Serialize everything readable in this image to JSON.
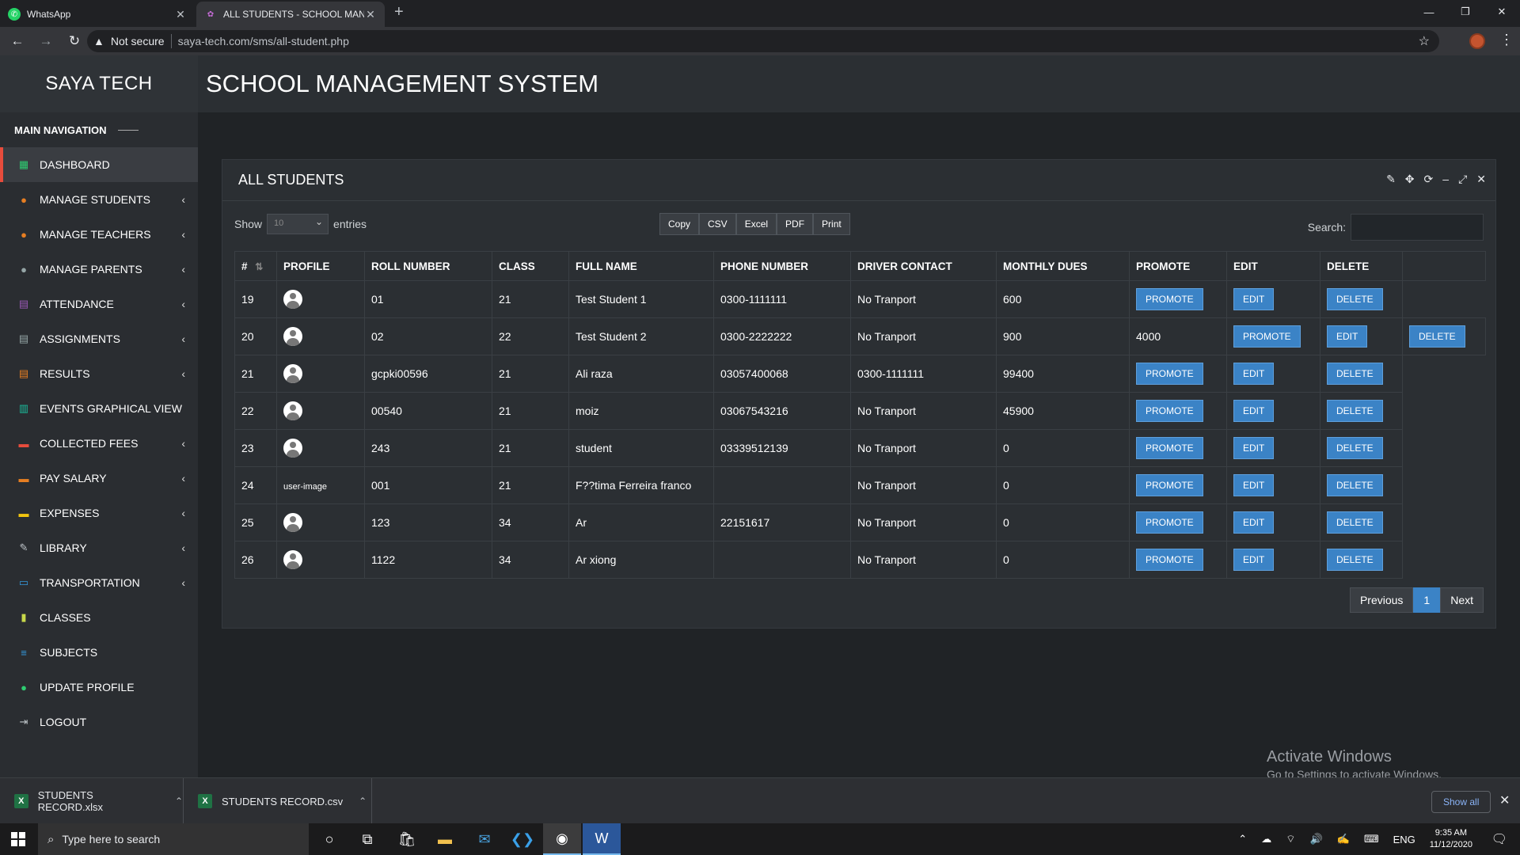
{
  "browser": {
    "tabs": [
      {
        "label": "WhatsApp",
        "icon": "whatsapp-icon",
        "active": false
      },
      {
        "label": "ALL STUDENTS - SCHOOL MANA",
        "icon": "site-favicon",
        "active": true
      }
    ],
    "security_label": "Not secure",
    "url": "saya-tech.com/sms/all-student.php"
  },
  "app": {
    "brand": "SAYA TECH",
    "title": "SCHOOL MANAGEMENT SYSTEM"
  },
  "sidebar": {
    "heading": "MAIN NAVIGATION",
    "items": [
      {
        "label": "DASHBOARD",
        "icon": "dashboard-icon",
        "color": "#2ecc71",
        "chevron": false,
        "active": true
      },
      {
        "label": "MANAGE STUDENTS",
        "icon": "student-icon",
        "color": "#e67e22",
        "chevron": true
      },
      {
        "label": "MANAGE TEACHERS",
        "icon": "teacher-icon",
        "color": "#e67e22",
        "chevron": true
      },
      {
        "label": "MANAGE PARENTS",
        "icon": "parent-icon",
        "color": "#95a5a6",
        "chevron": true
      },
      {
        "label": "ATTENDANCE",
        "icon": "clipboard-icon",
        "color": "#9b59b6",
        "chevron": true
      },
      {
        "label": "ASSIGNMENTS",
        "icon": "clipboard-icon",
        "color": "#95a5a6",
        "chevron": true
      },
      {
        "label": "RESULTS",
        "icon": "clipboard-icon",
        "color": "#e67e22",
        "chevron": true
      },
      {
        "label": "EVENTS GRAPHICAL VIEW",
        "icon": "calendar-icon",
        "color": "#1abc9c",
        "chevron": false
      },
      {
        "label": "COLLECTED FEES",
        "icon": "card-icon",
        "color": "#e74c3c",
        "chevron": true
      },
      {
        "label": "PAY SALARY",
        "icon": "card-icon",
        "color": "#e67e22",
        "chevron": true
      },
      {
        "label": "EXPENSES",
        "icon": "card-icon",
        "color": "#f1c40f",
        "chevron": true
      },
      {
        "label": "LIBRARY",
        "icon": "pen-icon",
        "color": "#bdc3c7",
        "chevron": true
      },
      {
        "label": "TRANSPORTATION",
        "icon": "bus-icon",
        "color": "#3498db",
        "chevron": true
      },
      {
        "label": "CLASSES",
        "icon": "book-icon",
        "color": "#c8d84a",
        "chevron": false
      },
      {
        "label": "SUBJECTS",
        "icon": "list-icon",
        "color": "#3498db",
        "chevron": false
      },
      {
        "label": "UPDATE PROFILE",
        "icon": "user-circle-icon",
        "color": "#2ecc71",
        "chevron": false
      },
      {
        "label": "LOGOUT",
        "icon": "logout-icon",
        "color": "#bdc3c7",
        "chevron": false
      }
    ]
  },
  "panel": {
    "title": "ALL STUDENTS",
    "show_label": "Show",
    "entries_value": "10",
    "entries_label": "entries",
    "export_buttons": [
      "Copy",
      "CSV",
      "Excel",
      "PDF",
      "Print"
    ],
    "search_label": "Search:",
    "columns": [
      "#",
      "PROFILE",
      "ROLL NUMBER",
      "CLASS",
      "FULL NAME",
      "PHONE NUMBER",
      "DRIVER CONTACT",
      "MONTHLY DUES",
      "PROMOTE",
      "EDIT",
      "DELETE"
    ],
    "rows": [
      {
        "id": "19",
        "roll": "01",
        "class": "21",
        "name": "Test Student 1",
        "phone": "0300-1111111",
        "driver": "No Tranport",
        "dues": "600"
      },
      {
        "id": "20",
        "roll": "02",
        "class": "22",
        "name": "Test Student 2",
        "phone": "0300-2222222",
        "driver": "No Tranport",
        "dues": "900",
        "extra": "4000"
      },
      {
        "id": "21",
        "roll": "gcpki00596",
        "class": "21",
        "name": "Ali raza",
        "phone": "03057400068",
        "driver": "0300-1111111",
        "dues": "99400"
      },
      {
        "id": "22",
        "roll": "00540",
        "class": "21",
        "name": "moiz",
        "phone": "03067543216",
        "driver": "No Tranport",
        "dues": "45900"
      },
      {
        "id": "23",
        "roll": "243",
        "class": "21",
        "name": "student",
        "phone": "03339512139",
        "driver": "No Tranport",
        "dues": "0"
      },
      {
        "id": "24",
        "roll": "001",
        "class": "21",
        "name": "F??tima Ferreira franco",
        "phone": "",
        "driver": "No Tranport",
        "dues": "0",
        "broken_image": "user-image"
      },
      {
        "id": "25",
        "roll": "123",
        "class": "34",
        "name": "Ar",
        "phone": "22151617",
        "driver": "No Tranport",
        "dues": "0"
      },
      {
        "id": "26",
        "roll": "1122",
        "class": "34",
        "name": "Ar xiong",
        "phone": "",
        "driver": "No Tranport",
        "dues": "0"
      }
    ],
    "promote_label": "PROMOTE",
    "edit_label": "EDIT",
    "delete_label": "DELETE",
    "pager": {
      "previous": "Previous",
      "current": "1",
      "next": "Next"
    }
  },
  "watermark": {
    "line1": "Activate Windows",
    "line2": "Go to Settings to activate Windows."
  },
  "downloads": {
    "files": [
      "STUDENTS RECORD.xlsx",
      "STUDENTS RECORD.csv"
    ],
    "show_all": "Show all"
  },
  "taskbar": {
    "search_placeholder": "Type here to search",
    "language": "ENG",
    "time": "9:35 AM",
    "date": "11/12/2020"
  },
  "colors": {
    "accent_button": "#3b83c6",
    "active_nav_border": "#e74c3c"
  }
}
